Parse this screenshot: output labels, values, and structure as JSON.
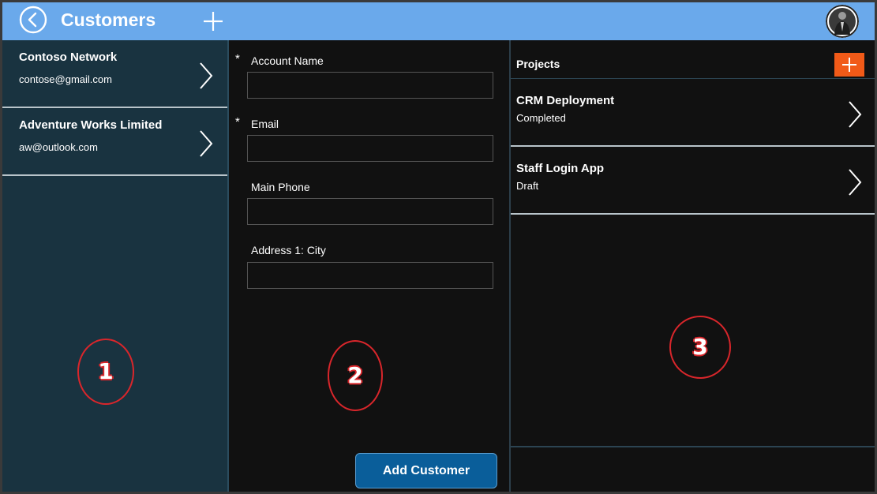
{
  "header": {
    "title": "Customers",
    "back_icon": "back-arrow-circle-icon",
    "add_icon": "plus-icon",
    "avatar_icon": "user-avatar-icon",
    "background_color": "#6aa9eb"
  },
  "customers": {
    "items": [
      {
        "name": "Contoso Network",
        "email": "contose@gmail.com"
      },
      {
        "name": "Adventure Works Limited",
        "email": "aw@outlook.com"
      }
    ],
    "panel_color": "#193340"
  },
  "form": {
    "fields": [
      {
        "label": "Account Name",
        "required": true,
        "value": ""
      },
      {
        "label": "Email",
        "required": true,
        "value": ""
      },
      {
        "label": "Main Phone",
        "required": false,
        "value": ""
      },
      {
        "label": "Address 1: City",
        "required": false,
        "value": ""
      }
    ],
    "required_marker": "*",
    "submit_label": "Add Customer",
    "submit_color": "#0a5e9a"
  },
  "projects": {
    "title": "Projects",
    "add_color": "#f15a18",
    "items": [
      {
        "name": "CRM Deployment",
        "status": "Completed"
      },
      {
        "name": "Staff Login App",
        "status": "Draft"
      }
    ]
  },
  "annotations": [
    "1",
    "2",
    "3"
  ],
  "annotation_color": "#d9262b"
}
